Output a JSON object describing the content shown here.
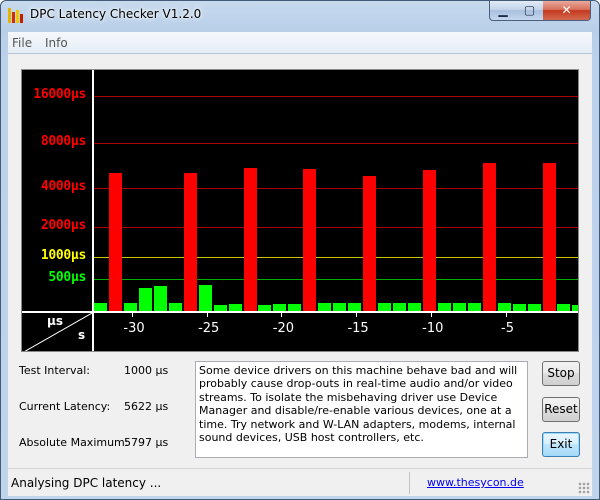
{
  "window": {
    "title": "DPC Latency Checker V1.2.0",
    "min_glyph": "▁",
    "max_glyph": "▢",
    "close_glyph": "✕"
  },
  "menu": [
    "File",
    "Info"
  ],
  "chart_data": {
    "type": "bar",
    "ylabels": [
      {
        "text": "16000µs",
        "value": 16000,
        "color": "#ff0000"
      },
      {
        "text": "8000µs",
        "value": 8000,
        "color": "#ff0000"
      },
      {
        "text": "4000µs",
        "value": 4000,
        "color": "#ff0000"
      },
      {
        "text": "2000µs",
        "value": 2000,
        "color": "#ff0000"
      },
      {
        "text": "1000µs",
        "value": 1000,
        "color": "#ffff00"
      },
      {
        "text": "500µs",
        "value": 500,
        "color": "#00ff00"
      }
    ],
    "xlabels": [
      "-30",
      "-25",
      "-20",
      "-15",
      "-10",
      "-5"
    ],
    "corner_top": "µs",
    "corner_bottom": "s",
    "bar_colors": {
      "ok": "#00ff00",
      "warn": "#ffff00",
      "bad": "#ff0000"
    },
    "values_us": [
      120,
      5300,
      120,
      360,
      390,
      120,
      5300,
      400,
      100,
      110,
      5800,
      100,
      110,
      110,
      5700,
      120,
      120,
      120,
      5100,
      120,
      120,
      120,
      5600,
      120,
      120,
      120,
      6200,
      130,
      110,
      110,
      6200,
      110,
      100,
      150
    ]
  },
  "info": {
    "test_interval_label": "Test Interval:",
    "test_interval_value": "1000 µs",
    "current_latency_label": "Current Latency:",
    "current_latency_value": "5622 µs",
    "absolute_max_label": "Absolute Maximum:",
    "absolute_max_value": "5797 µs"
  },
  "message": "Some device drivers on this machine behave bad and will probably cause drop-outs in real-time audio and/or video streams. To isolate the misbehaving driver use Device Manager and disable/re-enable various devices, one at a time. Try network and W-LAN adapters, modems, internal sound devices, USB host controllers, etc.",
  "buttons": {
    "stop": "Stop",
    "reset": "Reset",
    "exit": "Exit"
  },
  "status": {
    "text": "Analysing DPC latency ...",
    "link": "www.thesycon.de"
  },
  "icon_names": [
    "app-icon",
    "minimize-icon",
    "maximize-icon",
    "close-icon",
    "resize-grip-icon"
  ]
}
